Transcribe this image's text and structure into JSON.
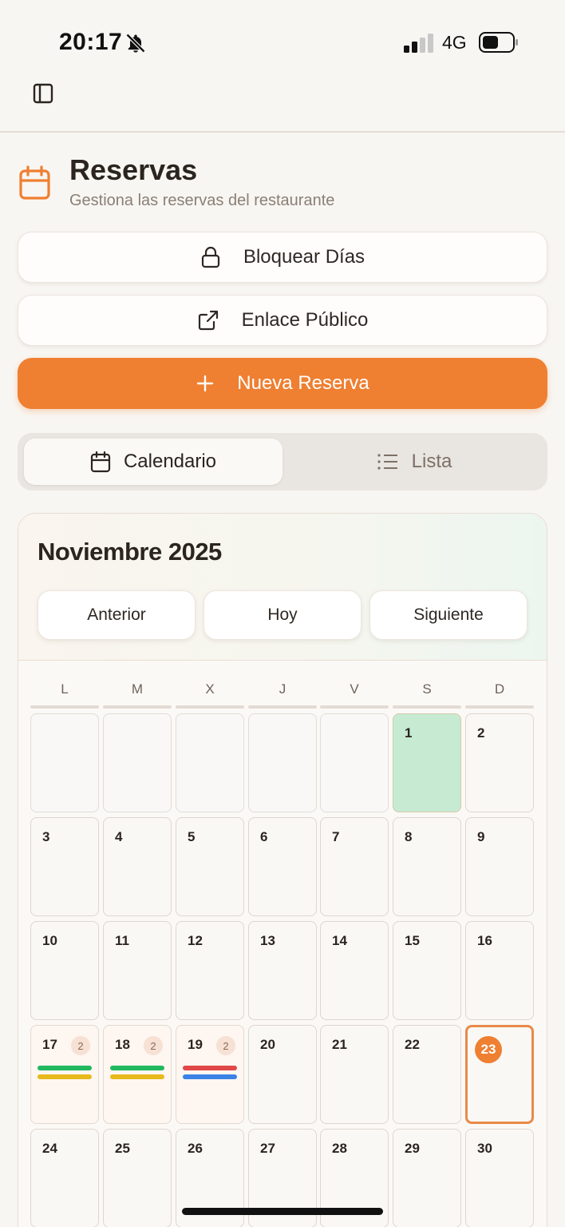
{
  "status_bar": {
    "time": "20:17",
    "network": "4G"
  },
  "header": {
    "title": "Reservas",
    "subtitle": "Gestiona las reservas del restaurante"
  },
  "actions": {
    "block_days": "Bloquear Días",
    "public_link": "Enlace Público",
    "new_reservation": "Nueva Reserva"
  },
  "view_tabs": {
    "calendar": "Calendario",
    "list": "Lista",
    "selected": "calendar"
  },
  "calendar": {
    "month": "Noviembre 2025",
    "prev": "Anterior",
    "today_btn": "Hoy",
    "next": "Siguiente",
    "weekdays": [
      "L",
      "M",
      "X",
      "J",
      "V",
      "S",
      "D"
    ],
    "leading_empty_days": 5,
    "today": 23,
    "blocked_days": [
      1
    ],
    "visible_days": [
      1,
      2,
      3,
      4,
      5,
      6,
      7,
      8,
      9,
      10,
      11,
      12,
      13,
      14,
      15,
      16,
      17,
      18,
      19,
      20,
      21,
      22,
      23,
      24,
      25,
      26,
      27,
      28,
      29,
      30
    ],
    "reservations": {
      "17": {
        "count": "2",
        "bars": [
          "#22b85f",
          "#e8b91a"
        ]
      },
      "18": {
        "count": "2",
        "bars": [
          "#22b85f",
          "#e8b91a"
        ]
      },
      "19": {
        "count": "2",
        "bars": [
          "#e04848",
          "#3b82e6"
        ]
      }
    }
  },
  "colors": {
    "accent": "#ef7f31",
    "blocked_day": "#c6ead2",
    "status_confirmed": "#22b85f",
    "status_pending": "#e8b91a",
    "status_cancelled": "#e04848",
    "status_seated": "#3b82e6"
  }
}
